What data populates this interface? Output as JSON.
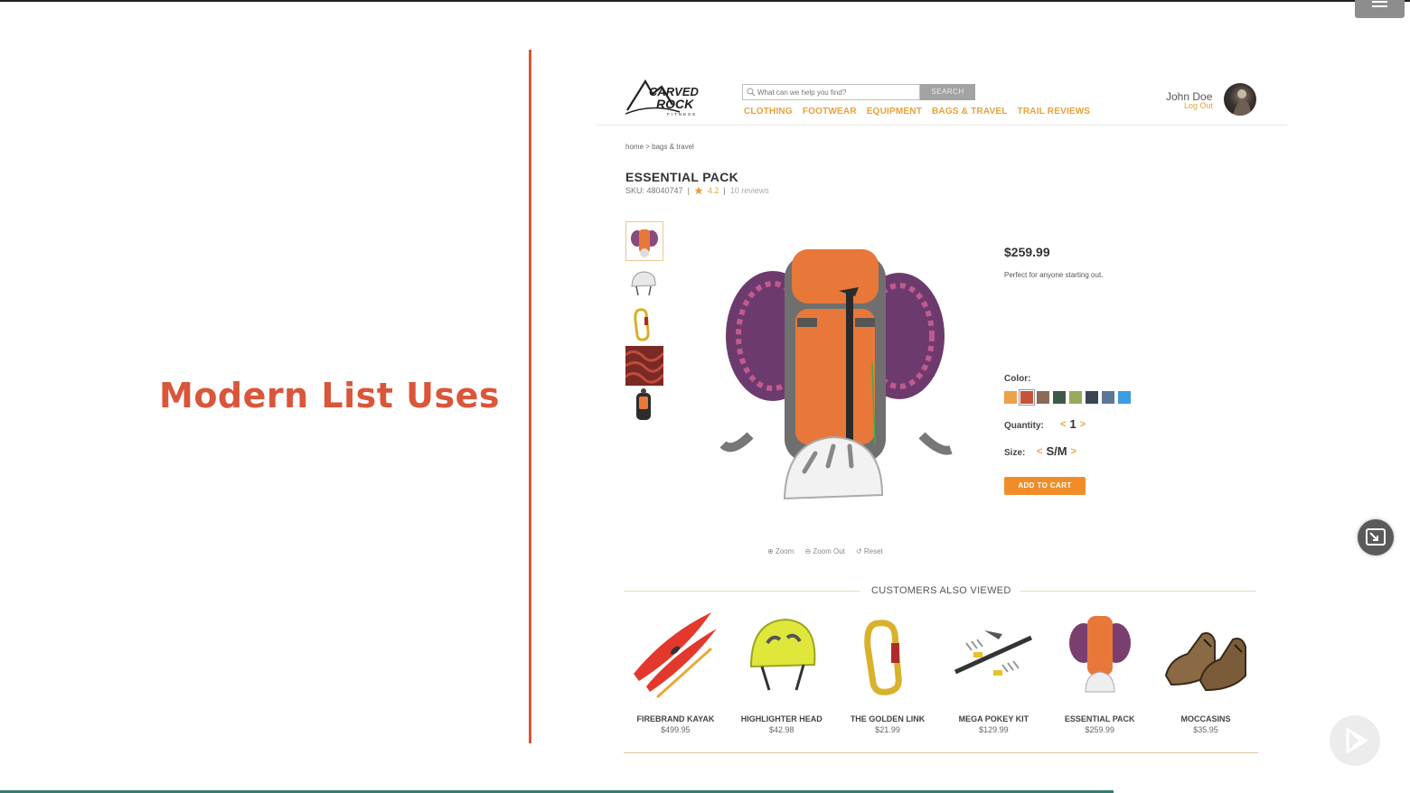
{
  "slide": {
    "title": "Modern List Uses"
  },
  "site": {
    "logo_text": "CARVED ROCK",
    "logo_sub": "FITNESS",
    "search": {
      "placeholder": "What can we help you find?",
      "button": "SEARCH"
    },
    "nav": [
      "CLOTHING",
      "FOOTWEAR",
      "EQUIPMENT",
      "BAGS & TRAVEL",
      "TRAIL REVIEWS"
    ],
    "user": {
      "name": "John Doe",
      "logout": "Log Out"
    }
  },
  "product": {
    "breadcrumb": "home > bags & travel",
    "title": "ESSENTIAL PACK",
    "sku": "SKU: 48040747",
    "rating": "4.2",
    "reviews": "10 reviews",
    "price": "$259.99",
    "description": "Perfect for anyone starting out.",
    "color_label": "Color:",
    "colors": [
      "#eba24a",
      "#c4543a",
      "#8b6b56",
      "#3f5a48",
      "#98a95e",
      "#3a4653",
      "#5d7896",
      "#3d9be2"
    ],
    "quantity_label": "Quantity:",
    "quantity": "1",
    "size_label": "Size:",
    "size": "S/M",
    "add_to_cart": "ADD TO CART",
    "zoom": {
      "zoom_in": "Zoom",
      "zoom_out": "Zoom Out",
      "reset": "Reset"
    }
  },
  "also_viewed": {
    "title": "CUSTOMERS ALSO VIEWED",
    "items": [
      {
        "name": "FIREBRAND KAYAK",
        "price": "$499.95"
      },
      {
        "name": "HIGHLIGHTER HEAD",
        "price": "$42.98"
      },
      {
        "name": "THE GOLDEN LINK",
        "price": "$21.99"
      },
      {
        "name": "MEGA POKEY KIT",
        "price": "$129.99"
      },
      {
        "name": "ESSENTIAL PACK",
        "price": "$259.99"
      },
      {
        "name": "MOCCASINS",
        "price": "$35.95"
      }
    ]
  },
  "icons": [
    "menu-icon",
    "search-icon",
    "star-icon",
    "zoom-in-icon",
    "zoom-out-icon",
    "reset-icon",
    "picture-in-picture-icon",
    "play-icon"
  ]
}
